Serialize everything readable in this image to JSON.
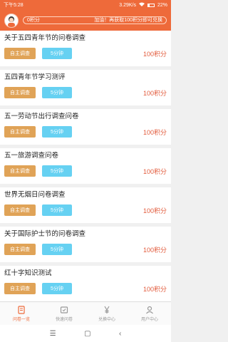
{
  "status_bar": {
    "time": "下午5:28",
    "network": "3.29K/s",
    "battery": "22%"
  },
  "header": {
    "points": "0积分",
    "hint": "加油！再获取100积分即可兑换",
    "progress": 0
  },
  "surveys": [
    {
      "title": "关于五四青年节的问卷调查",
      "type": "自主调查",
      "time": "5分钟",
      "points": "100积分"
    },
    {
      "title": "五四青年节学习测评",
      "type": "自主调查",
      "time": "5分钟",
      "points": "100积分"
    },
    {
      "title": "五一劳动节出行调查问卷",
      "type": "自主调查",
      "time": "5分钟",
      "points": "100积分"
    },
    {
      "title": "五一旅游调查问卷",
      "type": "自主调查",
      "time": "5分钟",
      "points": "100积分"
    },
    {
      "title": "世界无烟日问卷调查",
      "type": "自主调查",
      "time": "5分钟",
      "points": "100积分"
    },
    {
      "title": "关于国际护士节的问卷调查",
      "type": "自主调查",
      "time": "5分钟",
      "points": "100积分"
    },
    {
      "title": "红十字知识测试",
      "type": "自主调查",
      "time": "5分钟",
      "points": "100积分"
    }
  ],
  "tabs": [
    {
      "label": "问卷一览",
      "icon": "document-icon",
      "active": true
    },
    {
      "label": "快速问卷",
      "icon": "quick-survey-icon",
      "active": false
    },
    {
      "label": "兑换中心",
      "icon": "yen-icon",
      "active": false
    },
    {
      "label": "用户中心",
      "icon": "user-icon",
      "active": false
    }
  ],
  "colors": {
    "accent": "#ee6a3a",
    "type_button": "#e0a357",
    "time_button": "#66d1f2",
    "points_text": "#e25a3b"
  }
}
